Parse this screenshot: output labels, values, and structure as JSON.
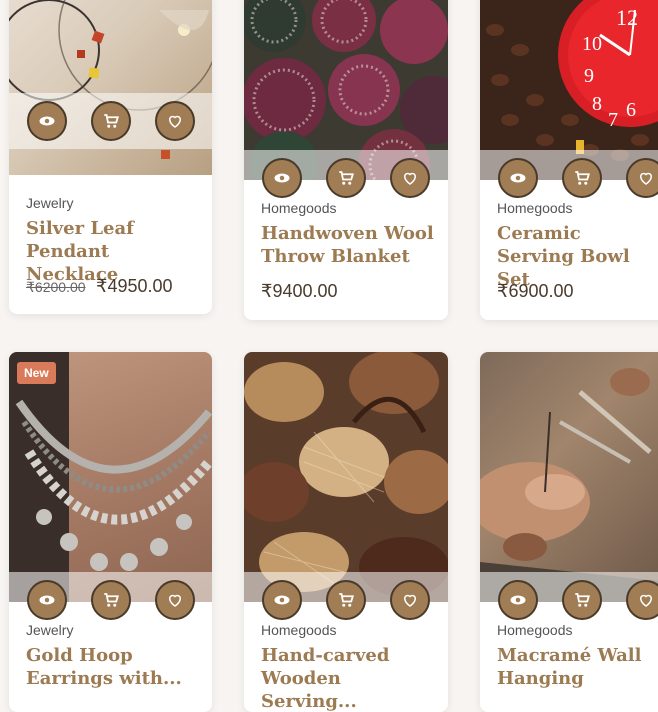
{
  "products": [
    {
      "category": "Jewelry",
      "title": "Silver Leaf Pendant Necklace",
      "old_price": "₹6200.00",
      "price": "₹4950.00"
    },
    {
      "category": "Homegoods",
      "title": "Handwoven Wool Throw Blanket",
      "price": "₹9400.00"
    },
    {
      "category": "Homegoods",
      "title": "Ceramic Serving Bowl Set",
      "price": "₹6900.00"
    },
    {
      "badge": "New",
      "category": "Jewelry",
      "title": "Gold Hoop Earrings with..."
    },
    {
      "category": "Homegoods",
      "title": "Hand-carved Wooden Serving..."
    },
    {
      "category": "Homegoods",
      "title": "Macramé Wall Hanging"
    }
  ],
  "icons": {
    "view": "eye-icon",
    "cart": "cart-icon",
    "wishlist": "heart-icon"
  },
  "colors": {
    "accent": "#a07d55",
    "title": "#9c7a52",
    "badge": "#d97b5a"
  }
}
